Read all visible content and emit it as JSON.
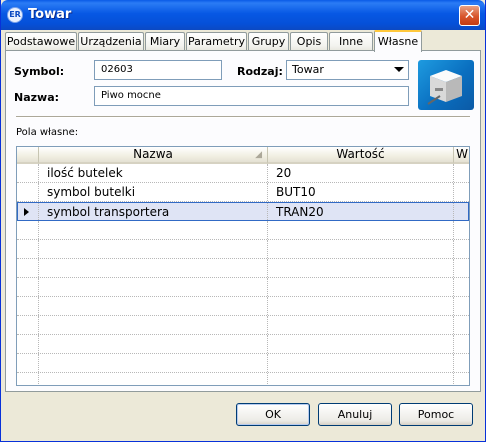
{
  "window": {
    "title": "Towar",
    "icon": "app-logo-icon",
    "close_icon": "close-icon"
  },
  "tabs": [
    {
      "label": "Podstawowe"
    },
    {
      "label": "Urządzenia"
    },
    {
      "label": "Miary"
    },
    {
      "label": "Parametry"
    },
    {
      "label": "Grupy"
    },
    {
      "label": "Opis"
    },
    {
      "label": "Inne"
    },
    {
      "label": "Własne",
      "active": true
    }
  ],
  "form": {
    "symbol_label": "Symbol:",
    "symbol_value": "02603",
    "rodzaj_label": "Rodzaj:",
    "rodzaj_value": "Towar",
    "nazwa_label": "Nazwa:",
    "nazwa_value": "Piwo mocne",
    "product_icon": "product-box-icon"
  },
  "custom_fields": {
    "section_label": "Pola własne:",
    "columns": [
      "Nazwa",
      "Wartość",
      "W"
    ],
    "rows": [
      {
        "name": "ilość butelek",
        "value": "20"
      },
      {
        "name": "symbol butelki",
        "value": "BUT10"
      },
      {
        "name": "symbol transportera",
        "value": "TRAN20",
        "selected": true
      }
    ],
    "empty_rows": 9
  },
  "buttons": {
    "ok": "OK",
    "cancel": "Anuluj",
    "help": "Pomoc"
  },
  "colors": {
    "title_bar": "#0758e4",
    "selection": "#dfe4f5",
    "selection_border": "#316ac5",
    "tab_highlight": "#ffc83c"
  }
}
